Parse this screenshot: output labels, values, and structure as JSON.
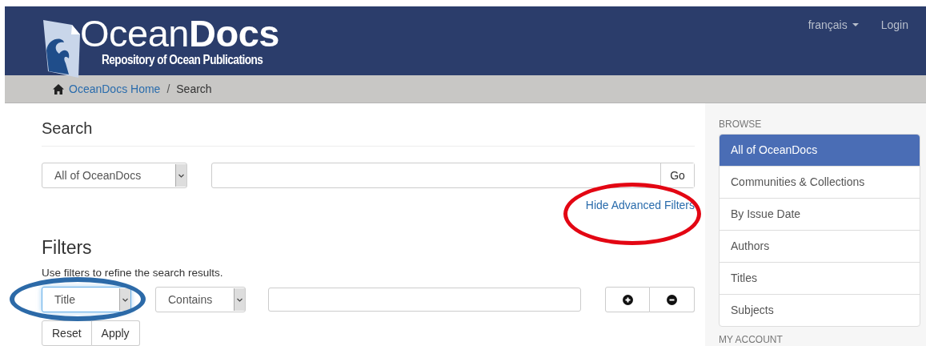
{
  "header": {
    "logo": {
      "name": "Ocean**Docs**",
      "tagline": "Repository of Ocean Publications"
    },
    "nav": [
      {
        "label": "français",
        "kind": "dropdown"
      },
      {
        "label": "Login",
        "kind": "link"
      }
    ]
  },
  "breadcrumb": [
    {
      "label": "OceanDocs Home",
      "kind": "home"
    },
    {
      "label": "/",
      "kind": "separator"
    },
    {
      "label": "Search",
      "kind": "current"
    }
  ],
  "search": {
    "title": "Search",
    "scope": "All of OceanDocs",
    "go": "Go",
    "toggle": {
      "label": "Hide Advanced Filters",
      "annotation": {
        "color": "#e30613"
      }
    }
  },
  "filters": {
    "title": "Filters",
    "help": "Use filters to refine the search results.",
    "rows": [
      {
        "field": {
          "value": "Title",
          "focused": true,
          "annotation": {
            "color": "#2c6aa8"
          }
        },
        "operator": "Contains"
      }
    ],
    "buttons": [
      "Reset",
      "Apply"
    ]
  },
  "sidebar": {
    "sections": [
      {
        "title": "BROWSE",
        "items": [
          {
            "label": "All of OceanDocs",
            "selected": true
          },
          {
            "label": "Communities & Collections",
            "selected": false
          },
          {
            "label": "By Issue Date",
            "selected": false
          },
          {
            "label": "Authors",
            "selected": false
          },
          {
            "label": "Titles",
            "selected": false
          },
          {
            "label": "Subjects",
            "selected": false
          }
        ]
      },
      {
        "title": "MY ACCOUNT"
      }
    ]
  }
}
